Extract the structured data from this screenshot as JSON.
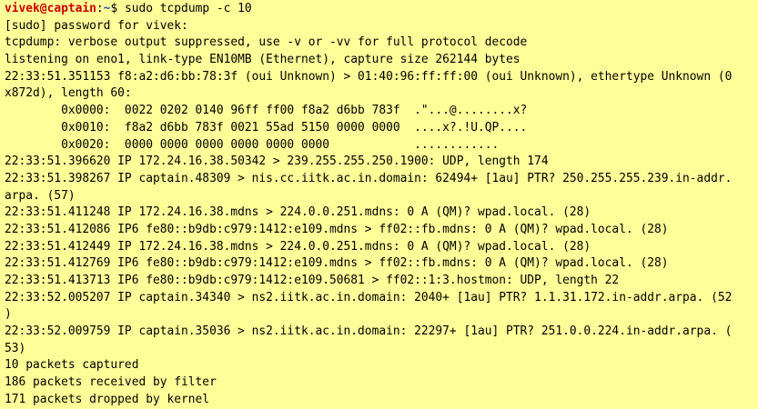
{
  "terminal": {
    "prompt": {
      "user_host": "vivek@captain",
      "separator": ":",
      "path": "~",
      "symbol": "$ ",
      "command": "sudo tcpdump -c 10"
    },
    "lines": [
      "[sudo] password for vivek:",
      "tcpdump: verbose output suppressed, use -v or -vv for full protocol decode",
      "listening on eno1, link-type EN10MB (Ethernet), capture size 262144 bytes",
      "22:33:51.351153 f8:a2:d6:bb:78:3f (oui Unknown) > 01:40:96:ff:ff:00 (oui Unknown), ethertype Unknown (0",
      "x872d), length 60:",
      "        0x0000:  0022 0202 0140 96ff ff00 f8a2 d6bb 783f  .\"...@........x?",
      "        0x0010:  f8a2 d6bb 783f 0021 55ad 5150 0000 0000  ....x?.!U.QP....",
      "        0x0020:  0000 0000 0000 0000 0000 0000            ............",
      "22:33:51.396620 IP 172.24.16.38.50342 > 239.255.255.250.1900: UDP, length 174",
      "22:33:51.398267 IP captain.48309 > nis.cc.iitk.ac.in.domain: 62494+ [1au] PTR? 250.255.255.239.in-addr.",
      "arpa. (57)",
      "22:33:51.411248 IP 172.24.16.38.mdns > 224.0.0.251.mdns: 0 A (QM)? wpad.local. (28)",
      "22:33:51.412086 IP6 fe80::b9db:c979:1412:e109.mdns > ff02::fb.mdns: 0 A (QM)? wpad.local. (28)",
      "22:33:51.412449 IP 172.24.16.38.mdns > 224.0.0.251.mdns: 0 A (QM)? wpad.local. (28)",
      "22:33:51.412769 IP6 fe80::b9db:c979:1412:e109.mdns > ff02::fb.mdns: 0 A (QM)? wpad.local. (28)",
      "22:33:51.413713 IP6 fe80::b9db:c979:1412:e109.50681 > ff02::1:3.hostmon: UDP, length 22",
      "22:33:52.005207 IP captain.34340 > ns2.iitk.ac.in.domain: 2040+ [1au] PTR? 1.1.31.172.in-addr.arpa. (52",
      ")",
      "22:33:52.009759 IP captain.35036 > ns2.iitk.ac.in.domain: 22297+ [1au] PTR? 251.0.0.224.in-addr.arpa. (",
      "53)",
      "10 packets captured",
      "186 packets received by filter",
      "171 packets dropped by kernel"
    ],
    "colors": {
      "background": "#ffff99",
      "text": "#000000",
      "prompt_user": "#cc0000",
      "prompt_path": "#1c4fd6"
    }
  }
}
